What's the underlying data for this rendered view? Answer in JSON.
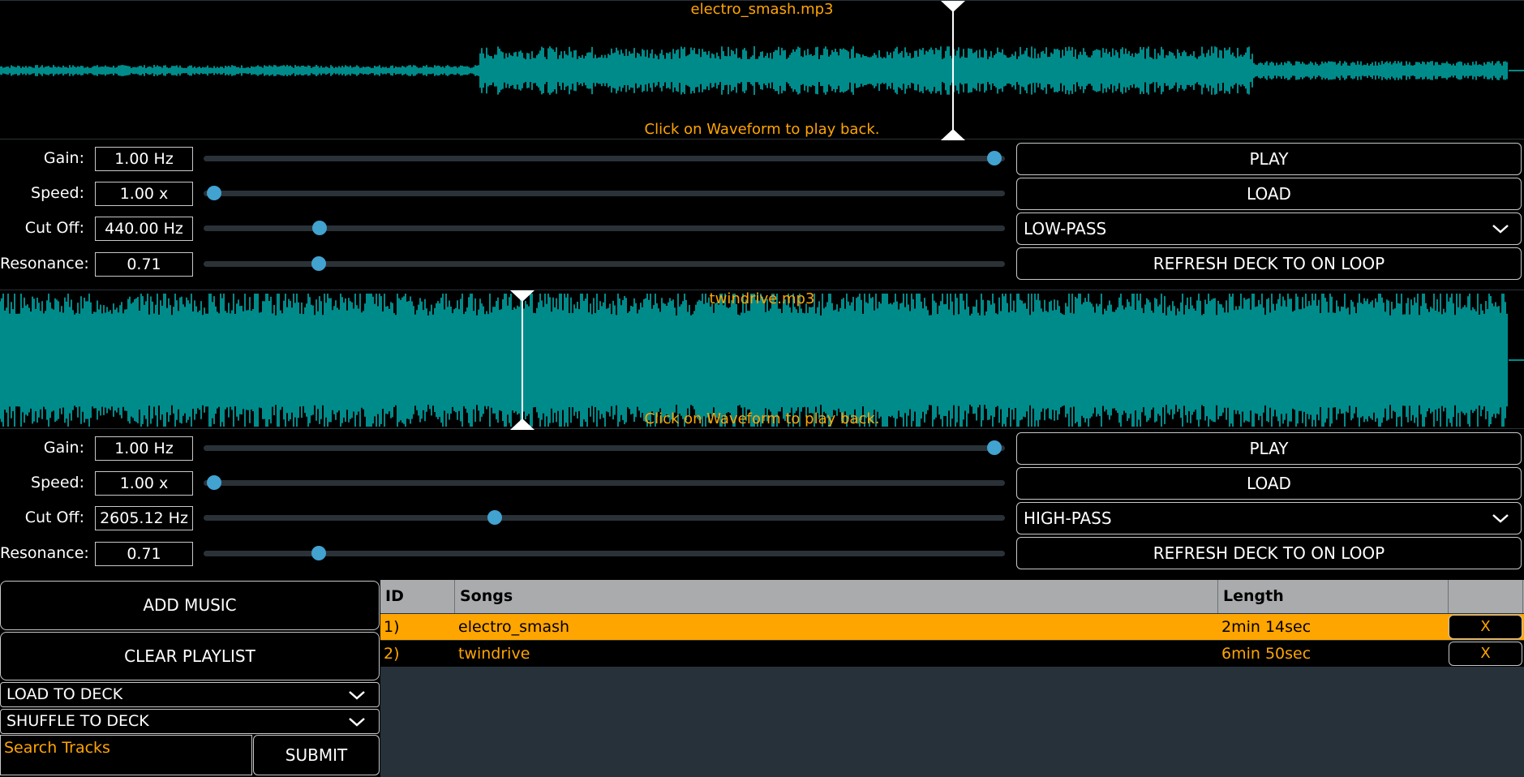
{
  "deck1": {
    "filename": "electro_smash.mp3",
    "hint": "Click on Waveform to play back.",
    "playhead_fraction": 0.625,
    "controls": [
      {
        "label": "Gain:",
        "value": "1.00 Hz",
        "slider_fraction": 1.0
      },
      {
        "label": "Speed:",
        "value": "1.00 x",
        "slider_fraction": 0.0
      },
      {
        "label": "Cut Off:",
        "value": "440.00 Hz",
        "slider_fraction": 0.135
      },
      {
        "label": "Resonance:",
        "value": "0.71",
        "slider_fraction": 0.134
      }
    ],
    "play_label": "PLAY",
    "load_label": "LOAD",
    "filter_selected": "LOW-PASS",
    "refresh_label": "REFRESH DECK TO ON LOOP"
  },
  "deck2": {
    "filename": "twindrive.mp3",
    "hint": "Click on Waveform to play back.",
    "playhead_fraction": 0.342,
    "controls": [
      {
        "label": "Gain:",
        "value": "1.00 Hz",
        "slider_fraction": 1.0
      },
      {
        "label": "Speed:",
        "value": "1.00 x",
        "slider_fraction": 0.0
      },
      {
        "label": "Cut Off:",
        "value": "2605.12 Hz",
        "slider_fraction": 0.36
      },
      {
        "label": "Resonance:",
        "value": "0.71",
        "slider_fraction": 0.134
      }
    ],
    "play_label": "PLAY",
    "load_label": "LOAD",
    "filter_selected": "HIGH-PASS",
    "refresh_label": "REFRESH DECK TO ON LOOP"
  },
  "library": {
    "add_music_label": "ADD MUSIC",
    "clear_playlist_label": "CLEAR PLAYLIST",
    "load_to_deck_label": "LOAD TO DECK",
    "shuffle_to_deck_label": "SHUFFLE TO DECK",
    "search_placeholder": "Search Tracks",
    "submit_label": "SUBMIT"
  },
  "playlist": {
    "headers": {
      "id": "ID",
      "songs": "Songs",
      "length": "Length"
    },
    "rows": [
      {
        "id": "1)",
        "song": "electro_smash",
        "length": "2min 14sec",
        "remove": "X",
        "selected": true
      },
      {
        "id": "2)",
        "song": "twindrive",
        "length": "6min 50sec",
        "remove": "X",
        "selected": false
      }
    ]
  },
  "colors": {
    "waveform": "#008b8b",
    "accent": "#ffa500",
    "slider_thumb": "#42a2d0",
    "slider_track": "#2a3238",
    "header_bg": "#a9abad",
    "panel_bg": "#27313a"
  },
  "icons": {
    "dropdown": "chevron-down-icon",
    "playhead": "playhead-marker"
  }
}
